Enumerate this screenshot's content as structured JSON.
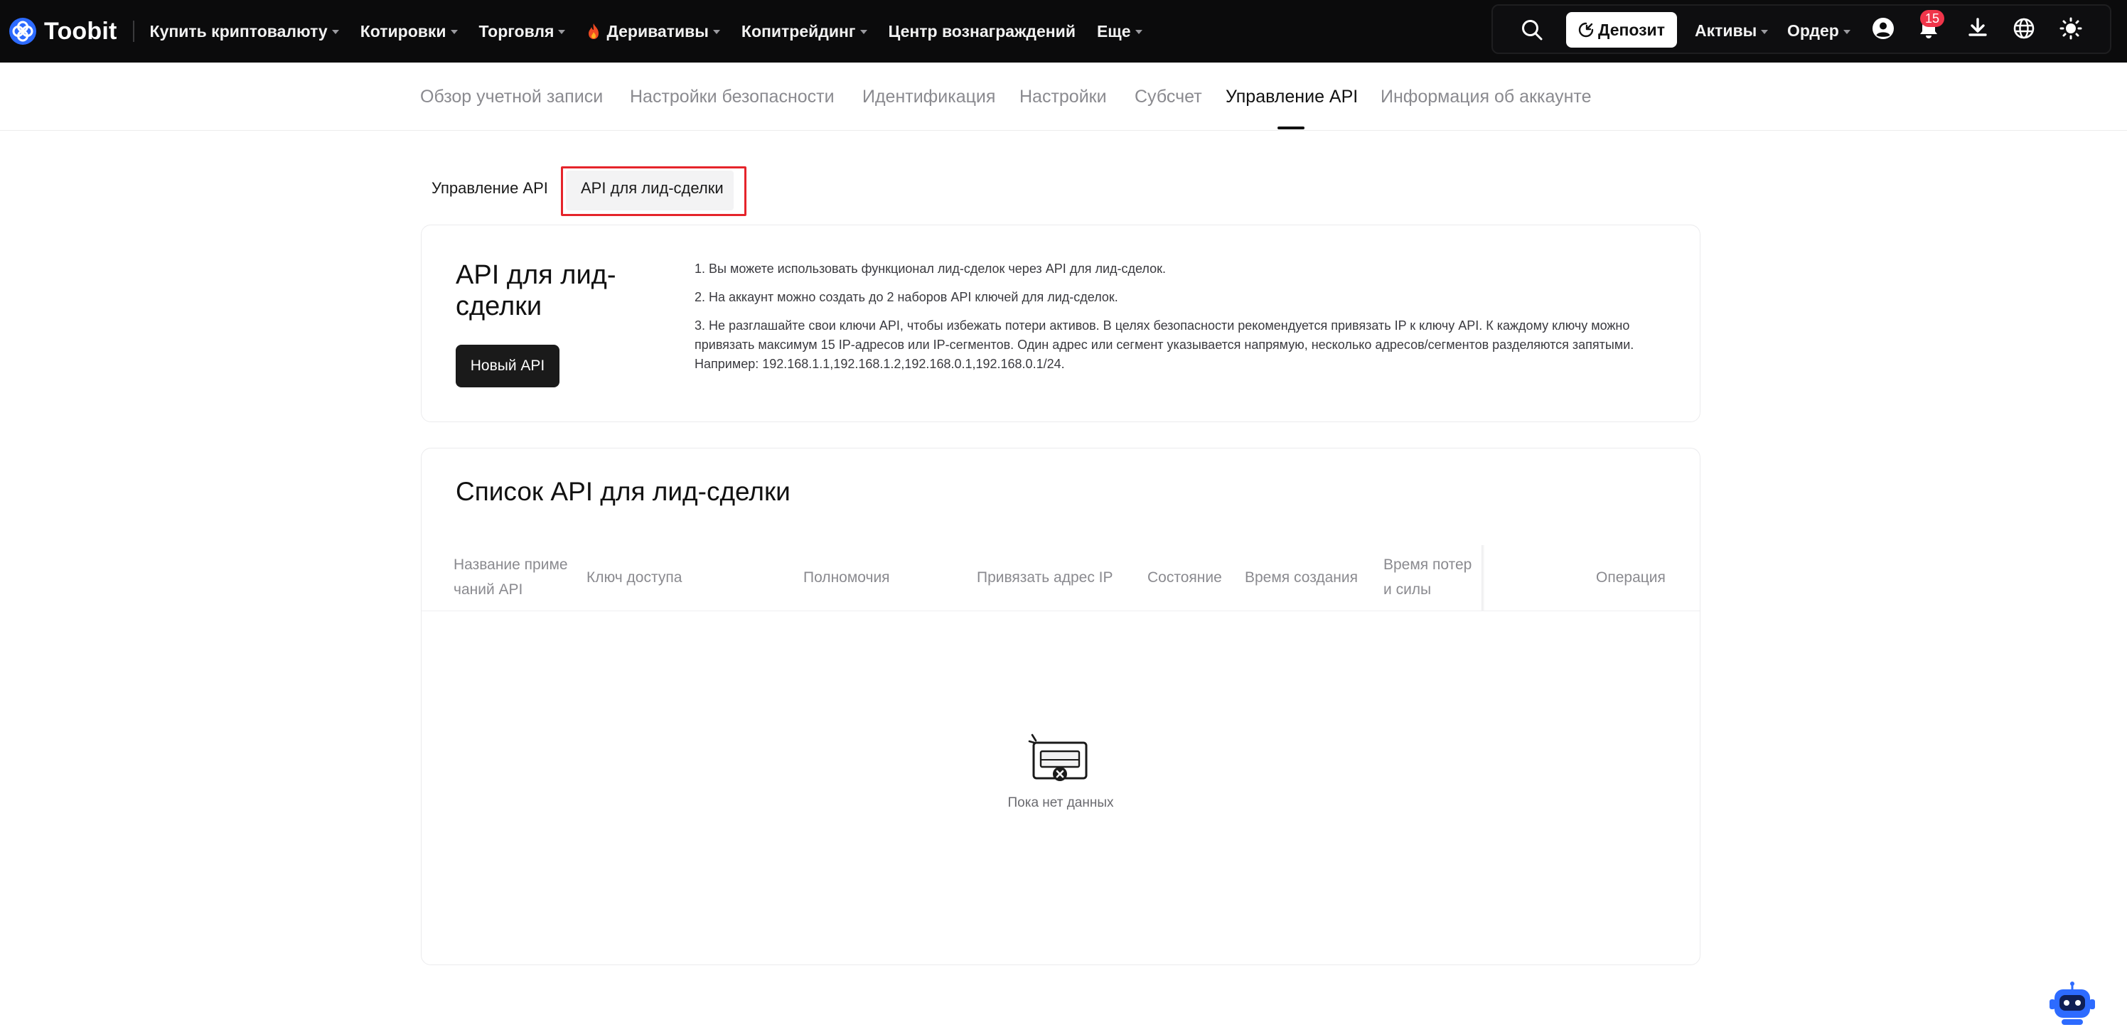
{
  "header": {
    "logo_text": "Toobit",
    "nav": [
      {
        "label": "Купить криптовалюту",
        "has_caret": true
      },
      {
        "label": "Котировки",
        "has_caret": true
      },
      {
        "label": "Торговля",
        "has_caret": true
      },
      {
        "label": "Деривативы",
        "has_caret": true,
        "icon": "fire-icon"
      },
      {
        "label": "Копитрейдинг",
        "has_caret": true
      },
      {
        "label": "Центр вознаграждений",
        "has_caret": false
      },
      {
        "label": "Еще",
        "has_caret": true
      }
    ],
    "deposit_label": "Депозит",
    "assets_label": "Активы",
    "orders_label": "Ордер",
    "notification_count": "15"
  },
  "account_tabs": [
    {
      "label": "Обзор учетной записи",
      "active": false
    },
    {
      "label": "Настройки безопасности",
      "active": false
    },
    {
      "label": "Идентификация",
      "active": false
    },
    {
      "label": "Настройки",
      "active": false
    },
    {
      "label": "Субсчет",
      "active": false
    },
    {
      "label": "Управление API",
      "active": true
    },
    {
      "label": "Информация об аккаунте",
      "active": false
    }
  ],
  "sub_tabs": [
    {
      "label": "Управление API",
      "active": false
    },
    {
      "label": "API для лид-сделки",
      "active": true
    }
  ],
  "info_card": {
    "title": "API для лид-сделки",
    "new_api_label": "Новый API",
    "notes": [
      "1. Вы можете использовать функционал лид-сделок через API для лид-сделок.",
      "2. На аккаунт можно создать до 2 наборов API ключей для лид-сделок.",
      "3. Не разглашайте свои ключи API, чтобы избежать потери активов. В целях безопасности рекомендуется привязать IP к ключу API. К каждому ключу можно привязать максимум 15 IP-адресов или IP-сегментов. Один адрес или сегмент указывается напрямую, несколько адресов/сегментов разделяются запятыми. Например: 192.168.1.1,192.168.1.2,192.168.0.1,192.168.0.1/24."
    ]
  },
  "list_card": {
    "title": "Список API для лид-сделки",
    "columns": {
      "remark": "Название приме чаний API",
      "access_key": "Ключ доступа",
      "permissions": "Полномочия",
      "bind_ip": "Привязать адрес IP",
      "status": "Состояние",
      "created": "Время создания",
      "expiry": "Время потер и силы",
      "operation": "Операция"
    },
    "empty_text": "Пока нет данных"
  },
  "colors": {
    "topbar_bg": "#0b0b0c",
    "accent_red": "#e5242b",
    "badge_red": "#f0354a",
    "logo_blue": "#2d6bff",
    "primary_button": "#1a1a1a"
  }
}
